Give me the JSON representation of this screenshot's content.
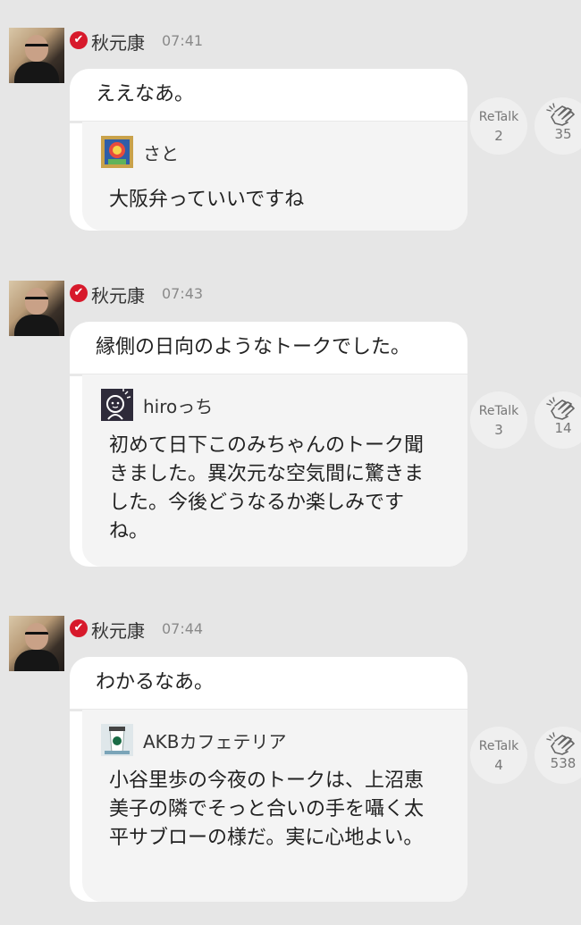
{
  "posts": [
    {
      "author": "秋元康",
      "time": "07:41",
      "text": "ええなあ。",
      "quote": {
        "user": "さと",
        "text": "大阪弁っていいですね"
      },
      "retalk_label": "ReTalk",
      "retalk_count": "2",
      "clap_count": "35"
    },
    {
      "author": "秋元康",
      "time": "07:43",
      "text": "縁側の日向のようなトークでした。",
      "quote": {
        "user": "hiroっち",
        "text": "初めて日下このみちゃんのトーク聞きました。異次元な空気間に驚きました。今後どうなるか楽しみですね。"
      },
      "retalk_label": "ReTalk",
      "retalk_count": "3",
      "clap_count": "14"
    },
    {
      "author": "秋元康",
      "time": "07:44",
      "text": "わかるなあ。",
      "quote": {
        "user": "AKBカフェテリア",
        "text": "小谷里歩の今夜のトークは、上沼恵美子の隣でそっと合いの手を囁く太平サブローの様だ。実に心地よい。"
      },
      "retalk_label": "ReTalk",
      "retalk_count": "4",
      "clap_count": "538"
    }
  ],
  "icons": {
    "verified": "check-badge-icon",
    "clap": "clap-hands-icon"
  },
  "colors": {
    "background": "#e6e6e6",
    "verified_badge": "#d7192b",
    "bubble": "#ffffff",
    "quote": "#f4f4f4"
  }
}
